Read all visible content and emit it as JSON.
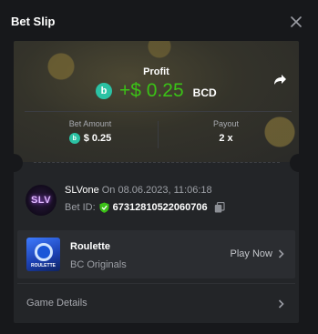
{
  "header": {
    "title": "Bet Slip"
  },
  "profit": {
    "label": "Profit",
    "value": "+$ 0.25",
    "currency": "BCD"
  },
  "bet_amount": {
    "label": "Bet Amount",
    "value": "$ 0.25"
  },
  "payout": {
    "label": "Payout",
    "value": "2 x"
  },
  "player": {
    "avatar_text": "SLV",
    "name": "SLVone",
    "timestamp": "On 08.06.2023, 11:06:18"
  },
  "bet_id": {
    "label": "Bet ID:",
    "value": "67312810522060706"
  },
  "game": {
    "title": "Roulette",
    "provider": "BC Originals",
    "thumb_label": "ROULETTE",
    "play_label": "Play Now"
  },
  "details": {
    "label": "Game Details"
  },
  "colors": {
    "accent_green": "#3bc117",
    "coin": "#2bc2a4",
    "background": "#17181b",
    "card": "#232528"
  },
  "icons": [
    "close-icon",
    "bcd-coin-icon",
    "share-icon",
    "shield-check-icon",
    "copy-icon",
    "chevron-right-icon"
  ]
}
